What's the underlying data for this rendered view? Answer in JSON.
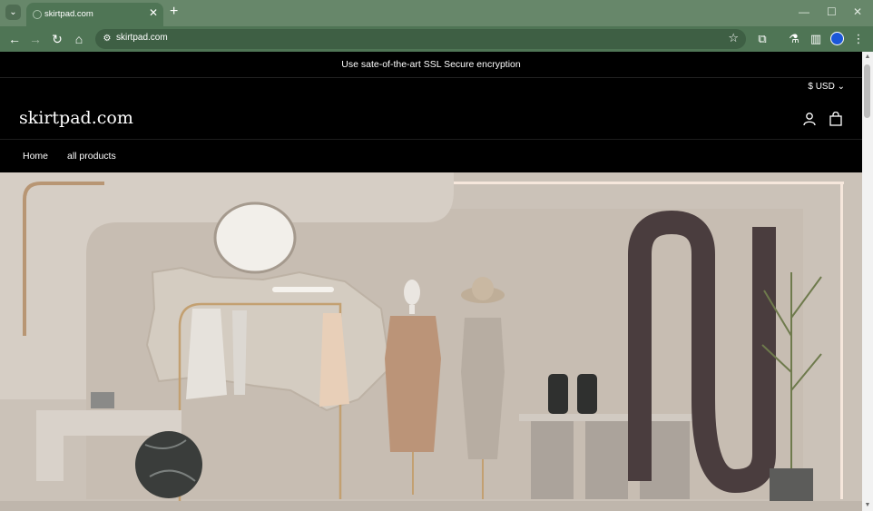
{
  "browser": {
    "tab_title": "skirtpad.com",
    "address": "skirtpad.com",
    "accent": "#4f7555"
  },
  "announcement": "Use sate-of-the-art SSL Secure encryption",
  "header": {
    "currency": "$ USD",
    "logo": "skirtpad.com",
    "icons": [
      "account-icon",
      "cart-icon"
    ]
  },
  "nav": {
    "items": [
      {
        "label": "Home"
      },
      {
        "label": "all products"
      }
    ]
  }
}
